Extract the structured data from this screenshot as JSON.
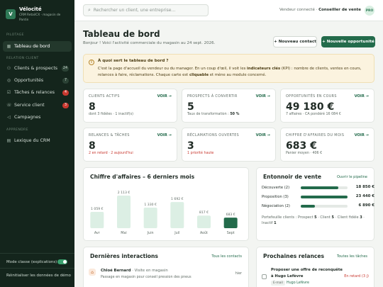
{
  "sidebar": {
    "logo": "V",
    "title": "Vélocité",
    "subtitle_line1": "CRM RetailCX · magasin de",
    "subtitle_line2": "Pantin",
    "sections": [
      "PILOTAGE",
      "RELATION CLIENT",
      "APPRENDRE"
    ],
    "items": [
      {
        "label": "Tableau de bord",
        "icon": "grid-icon"
      },
      {
        "label": "Clients & prospects",
        "icon": "users-icon",
        "count": "24"
      },
      {
        "label": "Opportunités",
        "icon": "target-icon",
        "count": "7"
      },
      {
        "label": "Tâches & relances",
        "icon": "check-icon",
        "count": "4"
      },
      {
        "label": "Service client",
        "icon": "headset-icon",
        "count": "3"
      },
      {
        "label": "Campagnes",
        "icon": "megaphone-icon"
      },
      {
        "label": "Lexique du CRM",
        "icon": "book-icon"
      }
    ],
    "mode_label": "Mode classe (explications)",
    "reset_label": "Réinitialiser les données de démo"
  },
  "topbar": {
    "search_placeholder": "Rechercher un client, une entreprise…",
    "connected_prefix": "Vendeur connecté ·",
    "connected_role": "Conseiller de vente",
    "avatar": "PRO"
  },
  "header": {
    "title": "Tableau de bord",
    "subtitle": "Bonjour ! Voici l'activité commerciale du magasin au 24 sept. 2026.",
    "new_contact": "+ Nouveau contact",
    "new_opportunity": "+ Nouvelle opportunité"
  },
  "info": {
    "title": "À quoi sert le tableau de bord ?",
    "line1a": "C'est la page d'accueil du vendeur ou du manager. En un coup d'œil, il voit les ",
    "line1b": "indicateurs clés",
    "line1c": " (KPI) : nombre de clients, ventes en cours,",
    "line2a": "relances à faire, réclamations. Chaque carte est ",
    "line2b": "cliquable",
    "line2c": " et mène au module concerné."
  },
  "kpis": [
    {
      "label": "CLIENTS ACTIFS",
      "link": "VOIR →",
      "value": "8",
      "sub": "dont 3 fidèles · 1 inactif(s)"
    },
    {
      "label": "PROSPECTS À CONVERTIR",
      "link": "VOIR →",
      "value": "5",
      "sub_a": "Taux de transformation : ",
      "sub_b": "50 %"
    },
    {
      "label": "OPPORTUNITÉS EN COURS",
      "link": "VOIR →",
      "value": "49 180 €",
      "sub": "7 affaires · CA pondéré 16 084 €"
    },
    {
      "label": "RELANCES & TÂCHES",
      "link": "VOIR →",
      "value": "8",
      "sub": "2 en retard · 2 aujourd'hui"
    },
    {
      "label": "RÉCLAMATIONS OUVERTES",
      "link": "VOIR →",
      "value": "3",
      "sub": "1 priorité haute"
    },
    {
      "label": "CHIFFRE D'AFFAIRES DU MOIS",
      "link": "VOIR →",
      "value": "683 €",
      "sub": "Panier moyen · 406 €"
    }
  ],
  "chart_data": {
    "type": "bar",
    "title": "Chiffre d'affaires – 6 derniers mois",
    "categories": [
      "Avr",
      "Mai",
      "Juin",
      "Juil",
      "Août",
      "Sept"
    ],
    "values": [
      1059,
      2113,
      1330,
      1692,
      817,
      683
    ],
    "value_labels": [
      "1 059 €",
      "2 113 €",
      "1 330 €",
      "1 692 €",
      "817 €",
      "683 €"
    ],
    "colors": {
      "past": "#dcefe4",
      "current": "#236b4b"
    }
  },
  "pipeline": {
    "title": "Entonnoir de vente",
    "link": "Ouvrir le pipeline",
    "stages": [
      {
        "label": "Découverte (2)",
        "value": "18 850 €",
        "fraction": 0.8
      },
      {
        "label": "Proposition (3)",
        "value": "23 440 €",
        "fraction": 1.0
      },
      {
        "label": "Négociation (2)",
        "value": "6 890 €",
        "fraction": 0.3
      }
    ],
    "footer_prefix": "Portefeuille clients : Prospect ",
    "prospect": "5",
    "client_prefix": " · Client ",
    "client": "5",
    "fidele_prefix": " · Client fidèle ",
    "fidele": "3",
    "inactif_prefix": " · Inactif ",
    "inactif": "1"
  },
  "interactions": {
    "title": "Dernières interactions",
    "link": "Tous les contacts",
    "name": "Chloé Bernard",
    "type": " · Visite en magasin",
    "when": "hier",
    "desc": "Passage en magasin pour conseil pression des pneus"
  },
  "relances": {
    "title": "Prochaines relances",
    "link": "Toutes les tâches",
    "task": "Proposer une offre de reconquête",
    "contact": "à Hugo Lefèvre",
    "status": "En retard (3 j)",
    "tag": "E-mail",
    "tag_contact": "Hugo Lefèvre"
  }
}
